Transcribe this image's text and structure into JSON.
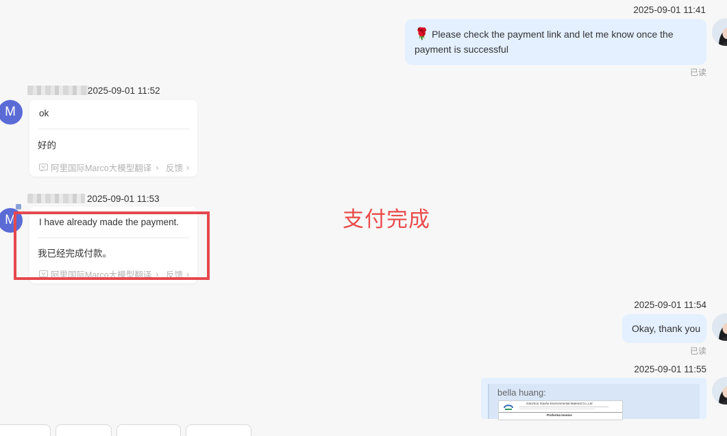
{
  "messages": {
    "m1": {
      "time": "2025-09-01 11:41",
      "text": "Please check the payment link and let me know once the payment is successful",
      "emoji": "🌹",
      "read": "已读"
    },
    "m2": {
      "time": "2025-09-01 11:52",
      "avatar": "M",
      "original": "ok",
      "translation": "好的",
      "translator": "阿里国际Marco大模型翻译",
      "feedback": "反馈"
    },
    "m3": {
      "time": "2025-09-01 11:53",
      "avatar": "M",
      "original": "I have already made the payment.",
      "translation": "我已经完成付款。",
      "translator": "阿里国际Marco大模型翻译",
      "feedback": "反馈"
    },
    "m4": {
      "time": "2025-09-01 11:54",
      "text": "Okay, thank you",
      "read": "已读"
    },
    "m5": {
      "time": "2025-09-01 11:55",
      "quote_author": "bella huang:",
      "doc_company": "Ganzhou Xiaohe Environmental Material Co.,Ltd",
      "doc_title": "Proforma Invoice"
    }
  },
  "annotation": {
    "label": "支付完成",
    "color": "#e5484d"
  },
  "colors": {
    "outgoing_bubble": "#e4f0ff",
    "avatar_m": "#5b6bd6",
    "background": "#f7f7f7"
  }
}
